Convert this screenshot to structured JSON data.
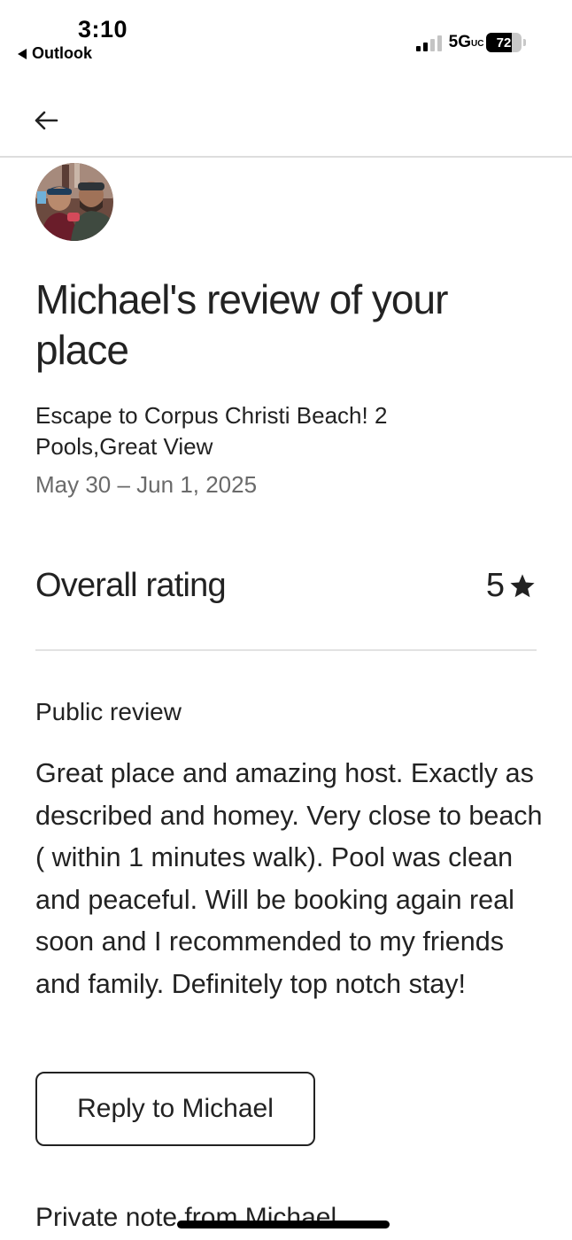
{
  "status_bar": {
    "time": "3:10",
    "back_app": "Outlook",
    "network": "5G",
    "network_suffix": "UC",
    "battery": "72",
    "battery_level": 0.72
  },
  "nav": {
    "back_icon": "arrow-left-icon"
  },
  "review": {
    "avatar_icon": "user-avatar-photo",
    "title": "Michael's review of your place",
    "listing_title": "Escape to Corpus Christi Beach! 2 Pools,Great View",
    "dates": "May 30 – Jun 1, 2025",
    "overall_rating_label": "Overall rating",
    "overall_rating_value": "5",
    "rating_icon": "star-icon",
    "public_review_label": "Public review",
    "public_review_text": "Great place and amazing host. Exactly as described and homey. Very close to beach ( within 1 minutes walk). Pool was clean and peaceful. Will be booking again real soon and I recommended to my friends and family. Definitely top notch stay!",
    "reply_button_label": "Reply to Michael",
    "private_note_label": "Private note from Michael"
  },
  "colors": {
    "text_primary": "#222222",
    "text_secondary": "#6a6a6a",
    "divider": "#dddddd",
    "background": "#ffffff"
  }
}
